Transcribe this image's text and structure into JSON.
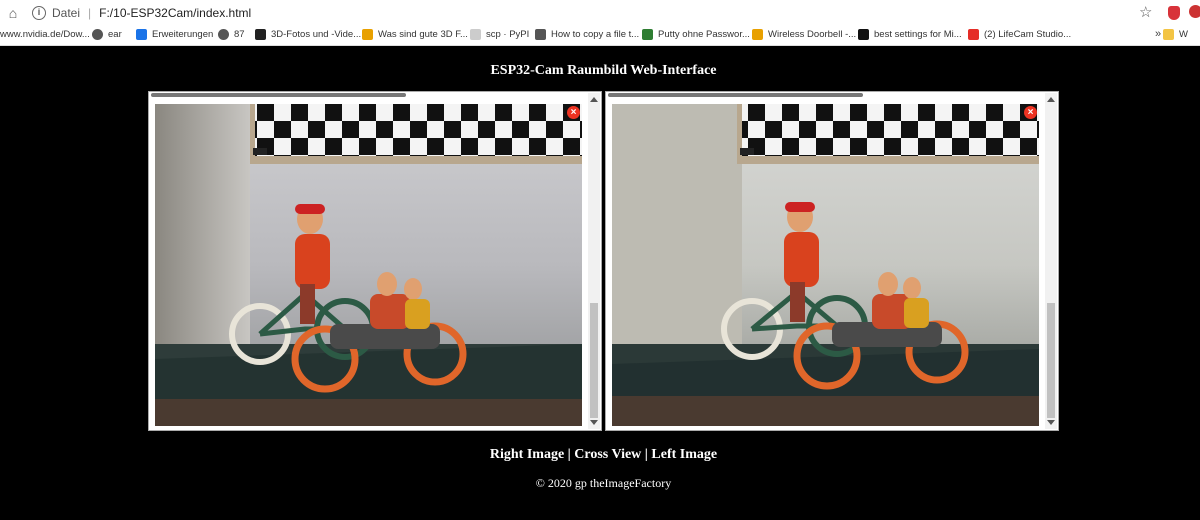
{
  "browser": {
    "scheme": "Datei",
    "url": "F:/10-ESP32Cam/index.html",
    "bookmarks": [
      {
        "label": "www.nvidia.de/Dow...",
        "icon": "none",
        "color": "#76b900"
      },
      {
        "label": "ear",
        "icon": "globe-icon",
        "color": "#555555"
      },
      {
        "label": "Erweiterungen",
        "icon": "puzzle-icon",
        "color": "#1a73e8"
      },
      {
        "label": "87",
        "icon": "globe-icon",
        "color": "#555555"
      },
      {
        "label": "3D-Fotos und -Vide...",
        "icon": "amazon-icon",
        "color": "#222222"
      },
      {
        "label": "Was sind gute 3D F...",
        "icon": "bookmark-icon",
        "color": "#e8a000"
      },
      {
        "label": "scp · PyPI",
        "icon": "bookmark-icon",
        "color": "#cccccc"
      },
      {
        "label": "How to copy a file t...",
        "icon": "diamond-icon",
        "color": "#555555"
      },
      {
        "label": "Putty ohne Passwor...",
        "icon": "bookmark-icon",
        "color": "#2e7d32"
      },
      {
        "label": "Wireless Doorbell -...",
        "icon": "bookmark-icon",
        "color": "#e8a000"
      },
      {
        "label": "best settings for Mi...",
        "icon": "bookmark-icon",
        "color": "#111111"
      },
      {
        "label": "(2) LifeCam Studio...",
        "icon": "youtube-icon",
        "color": "#e52d27"
      },
      {
        "label": "W",
        "icon": "folder-icon",
        "color": "#f3c444"
      }
    ],
    "more": "»"
  },
  "page": {
    "title": "ESP32-Cam Raumbild Web-Interface",
    "nav": {
      "right": "Right Image",
      "sep": " | ",
      "cross": "Cross View",
      "left": "Left Image"
    },
    "footer": "© 2020 gp theImageFactory"
  }
}
